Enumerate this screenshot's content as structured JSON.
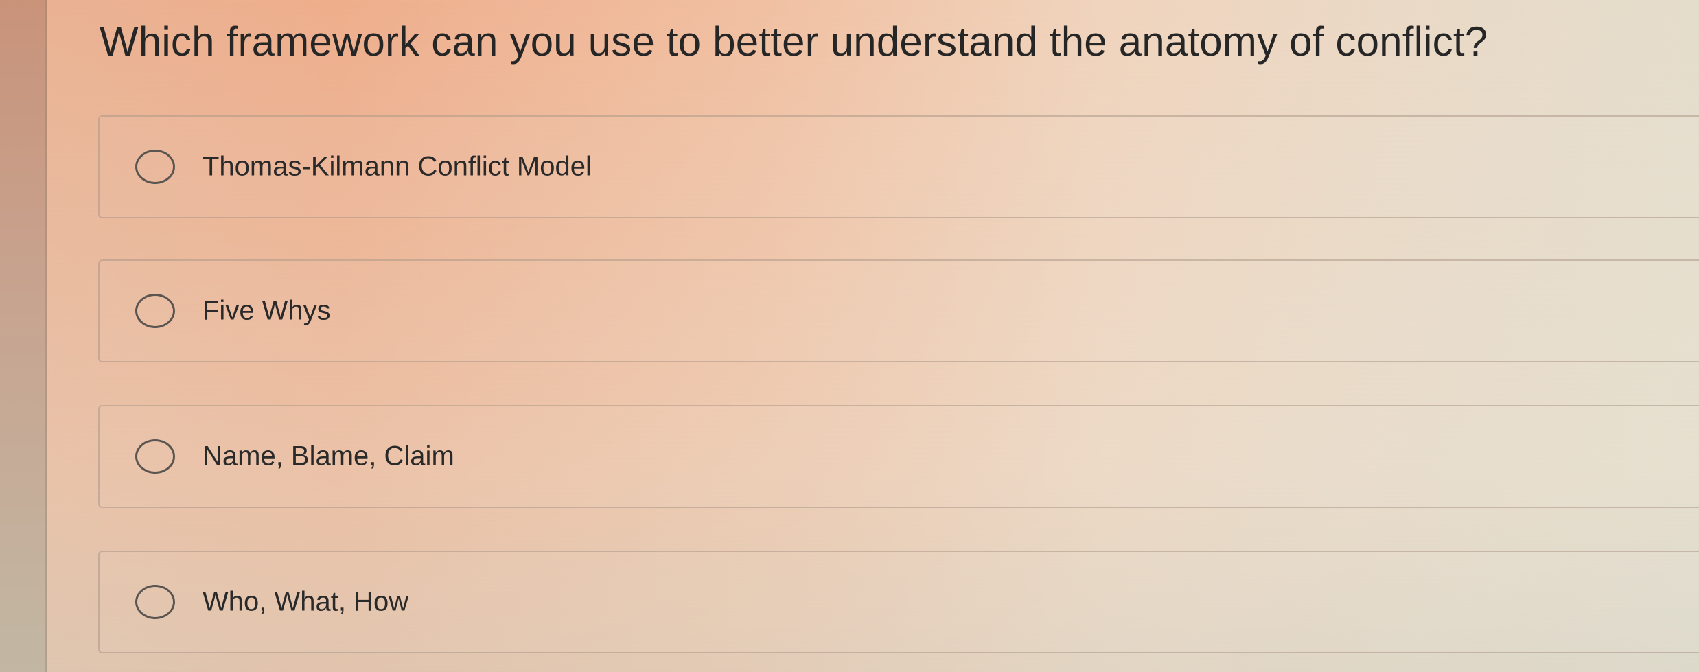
{
  "question": {
    "text": "Which framework can you use to better understand the anatomy of conflict?"
  },
  "options": [
    {
      "label": "Thomas-Kilmann Conflict Model",
      "selected": false
    },
    {
      "label": "Five Whys",
      "selected": false
    },
    {
      "label": "Name, Blame, Claim",
      "selected": false
    },
    {
      "label": "Who, What, How",
      "selected": false
    }
  ]
}
